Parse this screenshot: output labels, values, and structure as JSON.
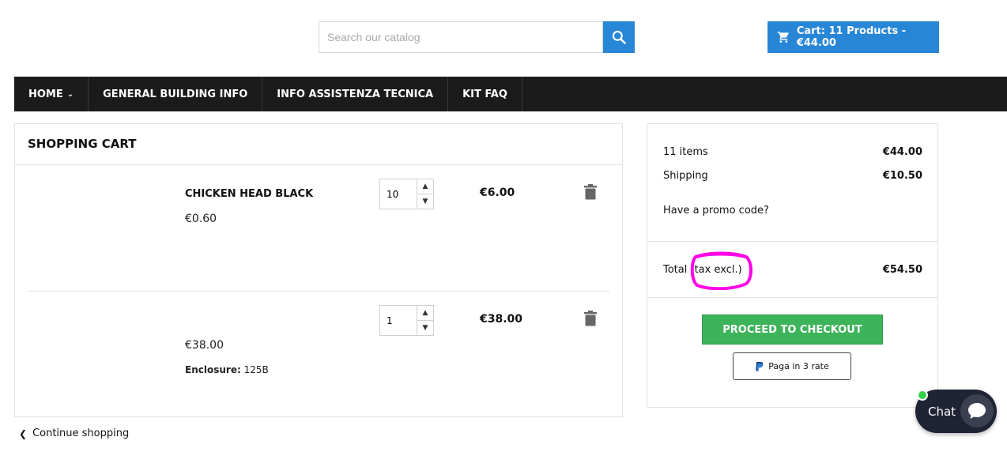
{
  "header": {
    "search_placeholder": "Search our catalog",
    "cart_label": "Cart: 11 Products - €44.00"
  },
  "nav": {
    "items": [
      {
        "label": "HOME",
        "has_dropdown": true
      },
      {
        "label": "GENERAL BUILDING INFO"
      },
      {
        "label": "INFO ASSISTENZA TECNICA"
      },
      {
        "label": "KIT FAQ"
      }
    ]
  },
  "cart": {
    "title": "SHOPPING CART",
    "items": [
      {
        "name": "CHICKEN HEAD BLACK",
        "unit_price": "€0.60",
        "quantity": "10",
        "line_total": "€6.00"
      },
      {
        "name": "",
        "unit_price": "€38.00",
        "quantity": "1",
        "line_total": "€38.00",
        "attr_label": "Enclosure:",
        "attr_value": "125B"
      }
    ],
    "continue_label": "Continue shopping"
  },
  "summary": {
    "items_label": "11 items",
    "items_value": "€44.00",
    "shipping_label": "Shipping",
    "shipping_value": "€10.50",
    "promo_label": "Have a promo code?",
    "total_label": "Total",
    "total_note": "(tax excl.)",
    "total_value": "€54.50",
    "checkout_label": "PROCEED TO CHECKOUT",
    "paypal_label": "Paga in 3 rate"
  },
  "chat": {
    "label": "Chat"
  },
  "colors": {
    "primary": "#2786d6",
    "nav_bg": "#1b1b1b",
    "checkout_green": "#3db35a",
    "highlight_magenta": "#ff00e6",
    "chat_bg": "#1f2333",
    "online_dot": "#37d04d"
  }
}
